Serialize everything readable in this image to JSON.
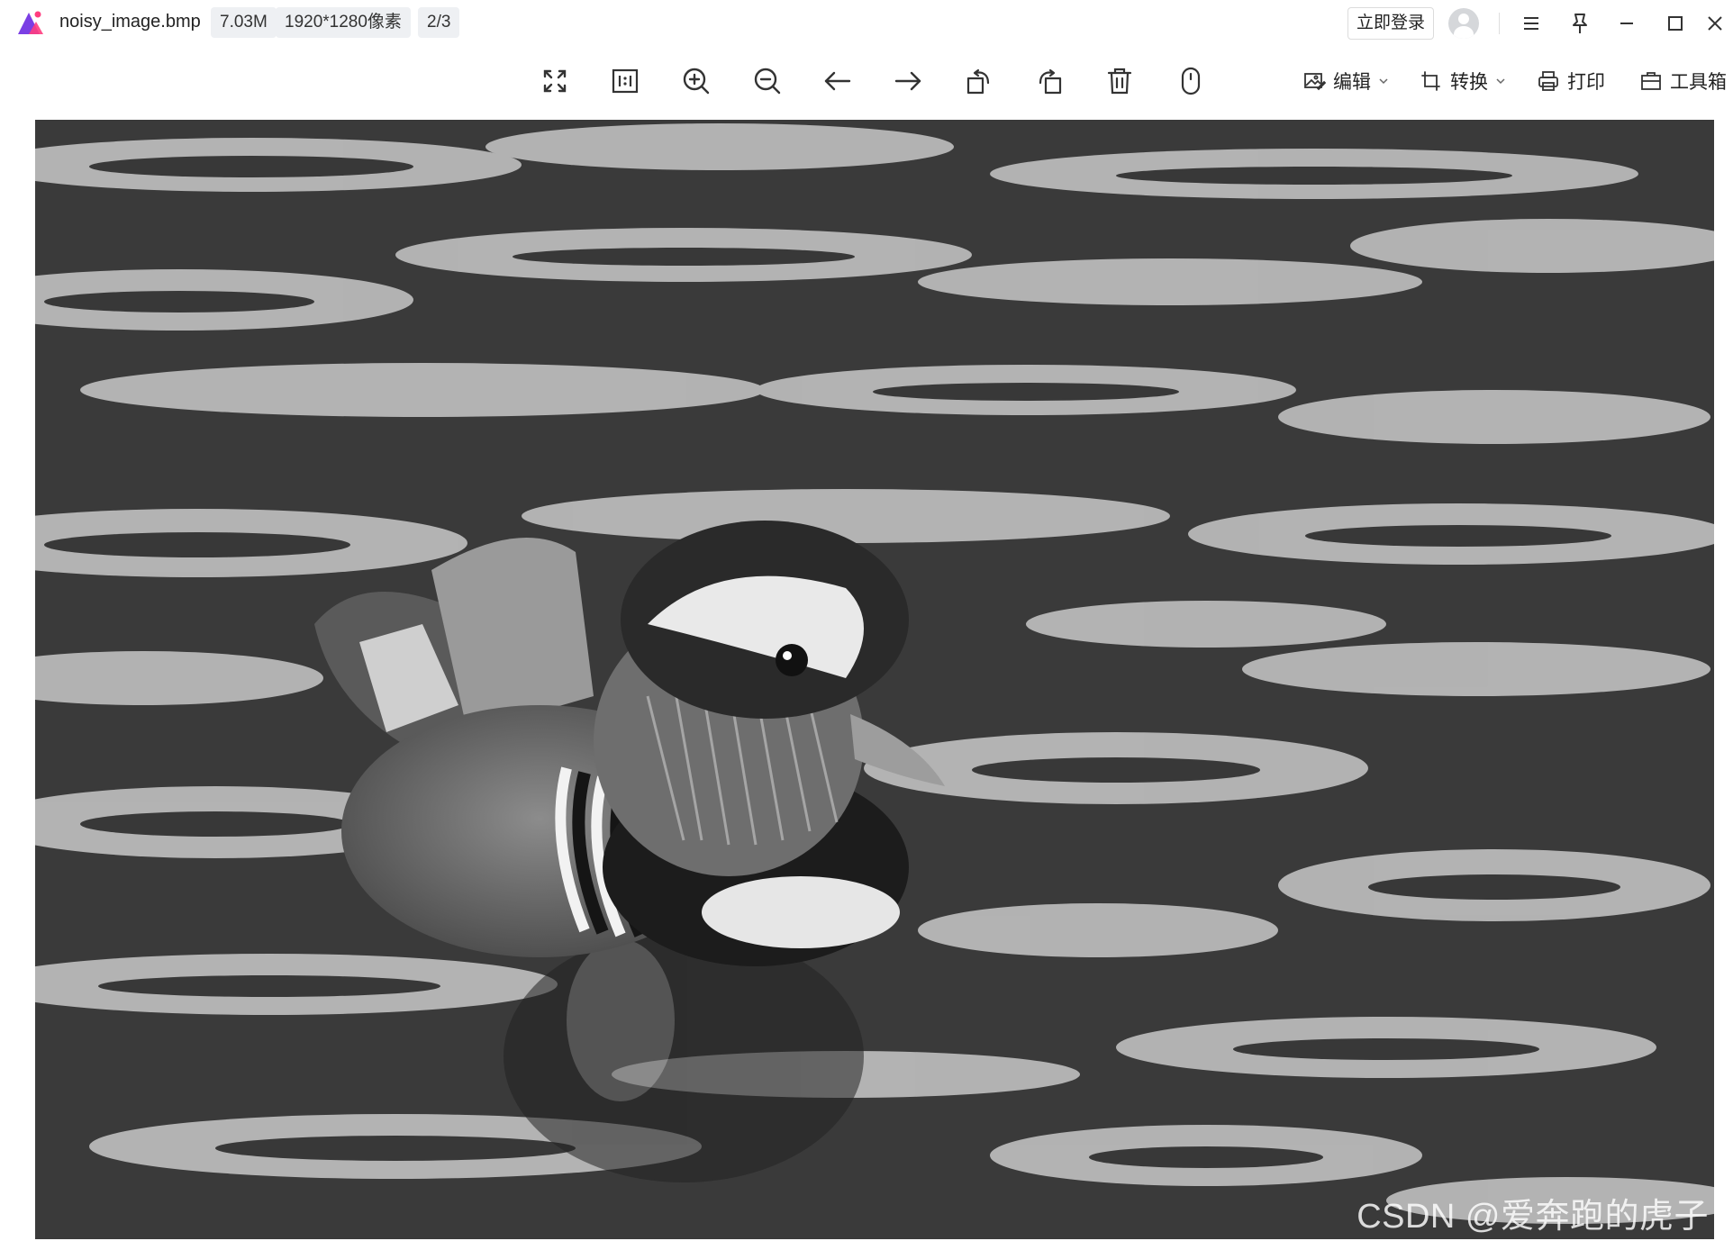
{
  "titlebar": {
    "filename": "noisy_image.bmp",
    "file_size": "7.03M",
    "dimensions": "1920*1280像素",
    "position": "2/3",
    "login_label": "立即登录"
  },
  "toolbar": {
    "icons": [
      "fullscreen-icon",
      "actual-size-icon",
      "zoom-in-icon",
      "zoom-out-icon",
      "previous-icon",
      "next-icon",
      "rotate-left-icon",
      "rotate-right-icon",
      "delete-icon",
      "mouse-icon"
    ],
    "edit_label": "编辑",
    "convert_label": "转换",
    "print_label": "打印",
    "toolbox_label": "工具箱"
  },
  "image": {
    "watermark": "CSDN @爱奔跑的虎子"
  },
  "colors": {
    "brand_purple": "#7b3fe4",
    "brand_pink": "#ff3d7f",
    "text": "#222222",
    "chip_bg": "#eef0f3"
  }
}
